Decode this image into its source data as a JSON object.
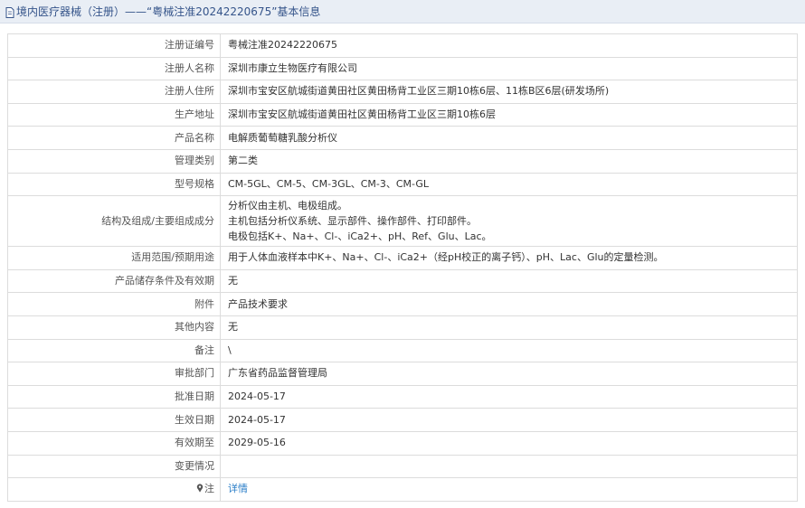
{
  "header": {
    "title": "境内医疗器械（注册）——“粤械注准20242220675”基本信息"
  },
  "rows": [
    {
      "label": "注册证编号",
      "value": "粤械注准20242220675"
    },
    {
      "label": "注册人名称",
      "value": "深圳市康立生物医疗有限公司"
    },
    {
      "label": "注册人住所",
      "value": "深圳市宝安区航城街道黄田社区黄田杨背工业区三期10栋6层、11栋B区6层(研发场所)"
    },
    {
      "label": "生产地址",
      "value": "深圳市宝安区航城街道黄田社区黄田杨背工业区三期10栋6层"
    },
    {
      "label": "产品名称",
      "value": "电解质葡萄糖乳酸分析仪"
    },
    {
      "label": "管理类别",
      "value": "第二类"
    },
    {
      "label": "型号规格",
      "value": "CM-5GL、CM-5、CM-3GL、CM-3、CM-GL"
    },
    {
      "label": "结构及组成/主要组成成分",
      "lines": [
        "分析仪由主机、电极组成。",
        "主机包括分析仪系统、显示部件、操作部件、打印部件。",
        "电极包括K+、Na+、Cl-、iCa2+、pH、Ref、Glu、Lac。"
      ]
    },
    {
      "label": "适用范围/预期用途",
      "value": "用于人体血液样本中K+、Na+、Cl-、iCa2+（经pH校正的离子钙）、pH、Lac、Glu的定量检测。"
    },
    {
      "label": "产品储存条件及有效期",
      "value": "无"
    },
    {
      "label": "附件",
      "value": "产品技术要求"
    },
    {
      "label": "其他内容",
      "value": "无"
    },
    {
      "label": "备注",
      "value": "\\"
    },
    {
      "label": "审批部门",
      "value": "广东省药品监督管理局"
    },
    {
      "label": "批准日期",
      "value": "2024-05-17"
    },
    {
      "label": "生效日期",
      "value": "2024-05-17"
    },
    {
      "label": "有效期至",
      "value": "2029-05-16"
    },
    {
      "label": "变更情况",
      "value": ""
    },
    {
      "label": "注",
      "value": "详情"
    }
  ]
}
